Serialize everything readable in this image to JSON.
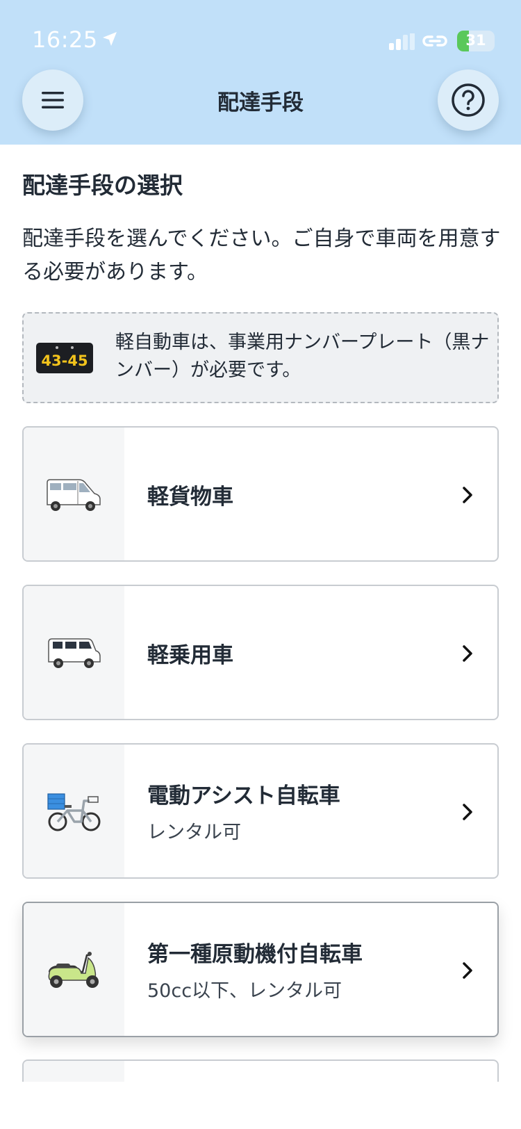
{
  "status_bar": {
    "time": "16:25",
    "battery": "31",
    "battery_level": 0.31,
    "icons": [
      "location-arrow-icon",
      "signal-icon",
      "link-icon",
      "battery-icon"
    ]
  },
  "nav": {
    "title": "配達手段",
    "menu_icon": "hamburger-menu-icon",
    "help_icon": "question-mark-icon"
  },
  "section": {
    "title": "配達手段の選択",
    "description": "配達手段を選んでください。ご自身で車両を用意する必要があります。"
  },
  "notice": {
    "plate_number": "43-45",
    "text": "軽自動車は、事業用ナンバープレート（黒ナンバー）が必要です。"
  },
  "options": [
    {
      "title": "軽貨物車",
      "subtitle": "",
      "icon": "van-icon"
    },
    {
      "title": "軽乗用車",
      "subtitle": "",
      "icon": "kei-car-icon"
    },
    {
      "title": "電動アシスト自転車",
      "subtitle": "レンタル可",
      "icon": "electric-bicycle-icon"
    },
    {
      "title": "第一種原動機付自転車",
      "subtitle": "50cc以下、レンタル可",
      "icon": "scooter-icon"
    }
  ],
  "colors": {
    "header_bg": "#c1e0f9",
    "text": "#222b36",
    "card_border": "#c8ccd1",
    "icon_panel": "#f5f6f7",
    "battery_green": "#5ac85a",
    "plate_yellow": "#f2c31c",
    "scooter_green": "#c9e68a",
    "bike_basket_blue": "#3b8fe0"
  }
}
